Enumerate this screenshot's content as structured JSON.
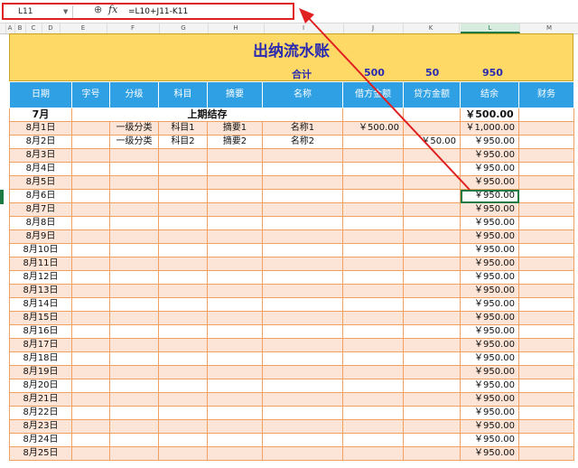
{
  "formula_bar": {
    "cell_ref": "L11",
    "fx_label": "fx",
    "formula": "=L10+J11-K11",
    "zoom_icon": "zoom-icon"
  },
  "columns": [
    "A",
    "B",
    "C",
    "D",
    "E",
    "F",
    "G",
    "H",
    "I",
    "J",
    "K",
    "L",
    "M"
  ],
  "sheet": {
    "title": "出纳流水账",
    "total_label": "合计",
    "total_debit": "500",
    "total_credit": "50",
    "total_balance": "950",
    "headers": [
      "日期",
      "字号",
      "分级",
      "科目",
      "摘要",
      "名称",
      "借方金额",
      "贷方金额",
      "结余",
      "财务"
    ],
    "carry_row": {
      "date": "7月",
      "summary": "上期结存",
      "balance": "￥500.00"
    },
    "rows": [
      {
        "date": "8月1日",
        "level": "一级分类",
        "subject": "科目1",
        "summary": "摘要1",
        "name": "名称1",
        "debit": "￥500.00",
        "credit": "",
        "balance": "￥1,000.00"
      },
      {
        "date": "8月2日",
        "level": "一级分类",
        "subject": "科目2",
        "summary": "摘要2",
        "name": "名称2",
        "debit": "",
        "credit": "￥50.00",
        "balance": "￥950.00"
      },
      {
        "date": "8月3日",
        "level": "",
        "subject": "",
        "summary": "",
        "name": "",
        "debit": "",
        "credit": "",
        "balance": "￥950.00"
      },
      {
        "date": "8月4日",
        "level": "",
        "subject": "",
        "summary": "",
        "name": "",
        "debit": "",
        "credit": "",
        "balance": "￥950.00"
      },
      {
        "date": "8月5日",
        "level": "",
        "subject": "",
        "summary": "",
        "name": "",
        "debit": "",
        "credit": "",
        "balance": "￥950.00"
      },
      {
        "date": "8月6日",
        "level": "",
        "subject": "",
        "summary": "",
        "name": "",
        "debit": "",
        "credit": "",
        "balance": "￥950.00"
      },
      {
        "date": "8月7日",
        "level": "",
        "subject": "",
        "summary": "",
        "name": "",
        "debit": "",
        "credit": "",
        "balance": "￥950.00"
      },
      {
        "date": "8月8日",
        "level": "",
        "subject": "",
        "summary": "",
        "name": "",
        "debit": "",
        "credit": "",
        "balance": "￥950.00"
      },
      {
        "date": "8月9日",
        "level": "",
        "subject": "",
        "summary": "",
        "name": "",
        "debit": "",
        "credit": "",
        "balance": "￥950.00"
      },
      {
        "date": "8月10日",
        "level": "",
        "subject": "",
        "summary": "",
        "name": "",
        "debit": "",
        "credit": "",
        "balance": "￥950.00"
      },
      {
        "date": "8月11日",
        "level": "",
        "subject": "",
        "summary": "",
        "name": "",
        "debit": "",
        "credit": "",
        "balance": "￥950.00"
      },
      {
        "date": "8月12日",
        "level": "",
        "subject": "",
        "summary": "",
        "name": "",
        "debit": "",
        "credit": "",
        "balance": "￥950.00"
      },
      {
        "date": "8月13日",
        "level": "",
        "subject": "",
        "summary": "",
        "name": "",
        "debit": "",
        "credit": "",
        "balance": "￥950.00"
      },
      {
        "date": "8月14日",
        "level": "",
        "subject": "",
        "summary": "",
        "name": "",
        "debit": "",
        "credit": "",
        "balance": "￥950.00"
      },
      {
        "date": "8月15日",
        "level": "",
        "subject": "",
        "summary": "",
        "name": "",
        "debit": "",
        "credit": "",
        "balance": "￥950.00"
      },
      {
        "date": "8月16日",
        "level": "",
        "subject": "",
        "summary": "",
        "name": "",
        "debit": "",
        "credit": "",
        "balance": "￥950.00"
      },
      {
        "date": "8月17日",
        "level": "",
        "subject": "",
        "summary": "",
        "name": "",
        "debit": "",
        "credit": "",
        "balance": "￥950.00"
      },
      {
        "date": "8月18日",
        "level": "",
        "subject": "",
        "summary": "",
        "name": "",
        "debit": "",
        "credit": "",
        "balance": "￥950.00"
      },
      {
        "date": "8月19日",
        "level": "",
        "subject": "",
        "summary": "",
        "name": "",
        "debit": "",
        "credit": "",
        "balance": "￥950.00"
      },
      {
        "date": "8月20日",
        "level": "",
        "subject": "",
        "summary": "",
        "name": "",
        "debit": "",
        "credit": "",
        "balance": "￥950.00"
      },
      {
        "date": "8月21日",
        "level": "",
        "subject": "",
        "summary": "",
        "name": "",
        "debit": "",
        "credit": "",
        "balance": "￥950.00"
      },
      {
        "date": "8月22日",
        "level": "",
        "subject": "",
        "summary": "",
        "name": "",
        "debit": "",
        "credit": "",
        "balance": "￥950.00"
      },
      {
        "date": "8月23日",
        "level": "",
        "subject": "",
        "summary": "",
        "name": "",
        "debit": "",
        "credit": "",
        "balance": "￥950.00"
      },
      {
        "date": "8月24日",
        "level": "",
        "subject": "",
        "summary": "",
        "name": "",
        "debit": "",
        "credit": "",
        "balance": "￥950.00"
      },
      {
        "date": "8月25日",
        "level": "",
        "subject": "",
        "summary": "",
        "name": "",
        "debit": "",
        "credit": "",
        "balance": "￥950.00"
      }
    ]
  },
  "colors": {
    "banner": "#ffd966",
    "header": "#2fa0e4",
    "row_alt": "#fce4d6",
    "highlight": "#e02020",
    "select": "#1e7a43"
  }
}
